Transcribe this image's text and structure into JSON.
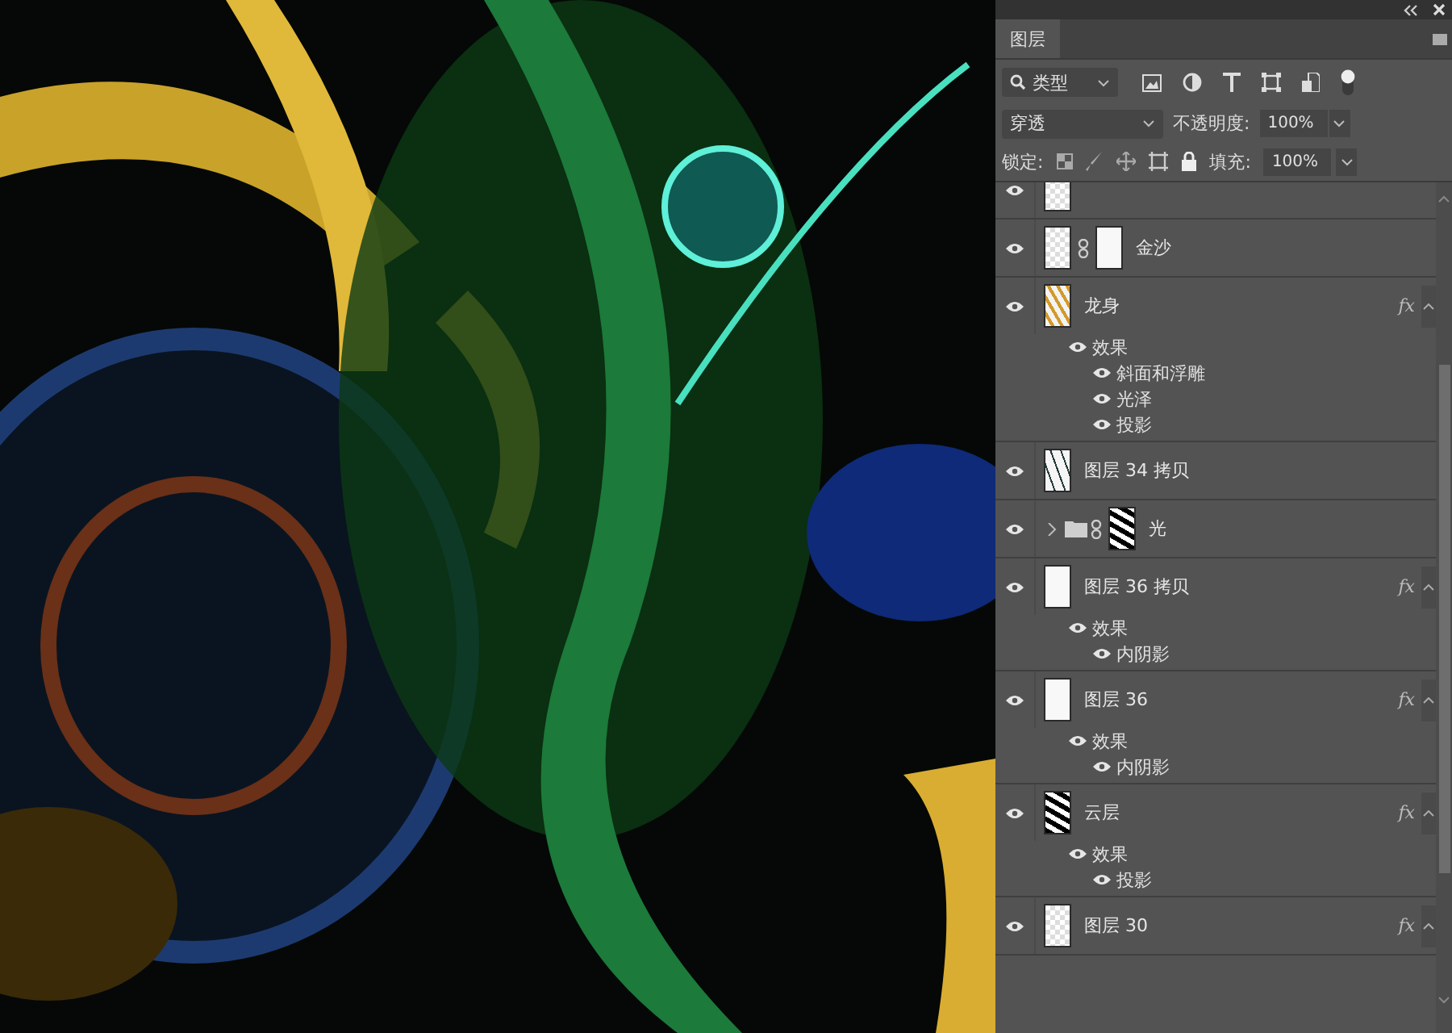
{
  "panel": {
    "tab": {
      "label": "图层",
      "selected": true
    },
    "filter": {
      "value": "类型"
    },
    "blend": {
      "value": "穿透"
    },
    "opacity": {
      "label": "不透明度:",
      "value": "100%"
    },
    "lock": {
      "label": "锁定:"
    },
    "fill": {
      "label": "填充:",
      "value": "100%"
    }
  },
  "layers": [
    {
      "kind": "layer",
      "visible": true,
      "thumbnail": {
        "kind": "transparent"
      },
      "partial": true
    },
    {
      "kind": "layer",
      "name": "金沙",
      "visible": true,
      "thumbnail": {
        "kind": "transparent"
      },
      "mask": {
        "kind": "white"
      }
    },
    {
      "kind": "layer",
      "name": "龙身",
      "visible": true,
      "thumbnail": {
        "kind": "gold"
      },
      "fx": "fx",
      "expanded": true,
      "effects": {
        "label": "效果",
        "visible": true,
        "items": [
          {
            "name": "斜面和浮雕",
            "visible": true
          },
          {
            "name": "光泽",
            "visible": true
          },
          {
            "name": "投影",
            "visible": true
          }
        ]
      }
    },
    {
      "kind": "layer",
      "name": "图层 34 拷贝",
      "visible": true,
      "thumbnail": {
        "kind": "strokes"
      }
    },
    {
      "kind": "group",
      "name": "光",
      "visible": true,
      "expanded": false,
      "mask": {
        "kind": "cloud"
      }
    },
    {
      "kind": "layer",
      "name": "图层 36 拷贝",
      "visible": true,
      "thumbnail": {
        "kind": "white"
      },
      "fx": "fx",
      "expanded": true,
      "effects": {
        "label": "效果",
        "visible": true,
        "items": [
          {
            "name": "内阴影",
            "visible": true
          }
        ]
      }
    },
    {
      "kind": "layer",
      "name": "图层 36",
      "visible": true,
      "thumbnail": {
        "kind": "white"
      },
      "fx": "fx",
      "expanded": true,
      "effects": {
        "label": "效果",
        "visible": true,
        "items": [
          {
            "name": "内阴影",
            "visible": true
          }
        ]
      }
    },
    {
      "kind": "layer",
      "name": "云层",
      "visible": true,
      "thumbnail": {
        "kind": "cloud"
      },
      "fx": "fx",
      "expanded": true,
      "effects": {
        "label": "效果",
        "visible": true,
        "items": [
          {
            "name": "投影",
            "visible": true
          }
        ]
      }
    },
    {
      "kind": "layer",
      "name": "图层 30",
      "visible": true,
      "thumbnail": {
        "kind": "transparent"
      },
      "fx": "fx",
      "expanded": true
    }
  ]
}
